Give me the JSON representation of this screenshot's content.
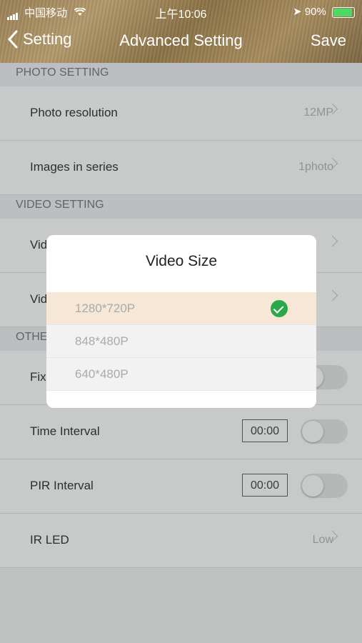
{
  "status": {
    "carrier": "中国移动",
    "time": "上午10:06",
    "battery": "90%"
  },
  "nav": {
    "back_label": "Setting",
    "title": "Advanced Setting",
    "save_label": "Save"
  },
  "photo_section": {
    "header": "PHOTO SETTING",
    "rows": [
      {
        "label": "Photo resolution",
        "value": "12MP"
      },
      {
        "label": "Images in series",
        "value": "1photo"
      }
    ]
  },
  "video_section": {
    "header": "VIDEO SETTING",
    "rows": [
      {
        "label": "Vid"
      },
      {
        "label": "Vid"
      }
    ]
  },
  "other_section": {
    "header": "OTHE",
    "rows": [
      {
        "label": "Fix"
      },
      {
        "label": "Time Interval",
        "time": "00:00"
      },
      {
        "label": "PIR Interval",
        "time": "00:00"
      },
      {
        "label": "IR LED",
        "value": "Low"
      }
    ]
  },
  "dialog": {
    "title": "Video Size",
    "options": [
      "1280*720P",
      "848*480P",
      "640*480P"
    ],
    "selected_index": 0
  },
  "colors": {
    "check": "#2ba84a",
    "selected_bg": "#f6e7d6"
  }
}
